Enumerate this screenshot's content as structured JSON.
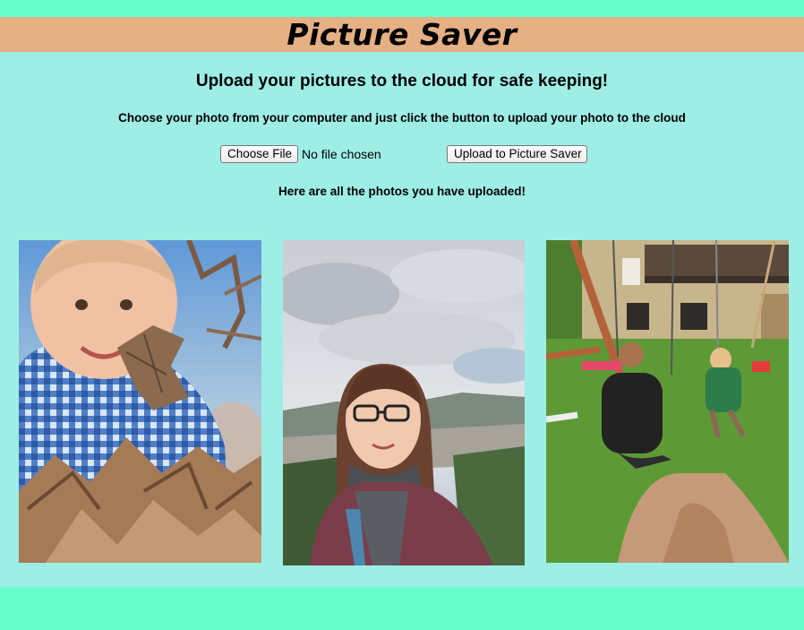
{
  "header": {
    "title": "Picture Saver"
  },
  "main": {
    "subtitle": "Upload your pictures to the cloud for safe keeping!",
    "instructions": "Choose your photo from your computer and just click the button to upload your photo to the cloud",
    "file_input": {
      "button_label": "Choose File",
      "status": "No file chosen"
    },
    "upload_button": "Upload to Picture Saver",
    "uploaded_heading": "Here are all the photos you have uploaded!"
  },
  "photos": [
    {
      "name": "photo-toddler-leaves"
    },
    {
      "name": "photo-woman-selfie"
    },
    {
      "name": "photo-swing-backyard"
    }
  ],
  "colors": {
    "page_background": "#66ffcc",
    "header_background": "#e4b084",
    "content_background": "#9eeee6"
  }
}
